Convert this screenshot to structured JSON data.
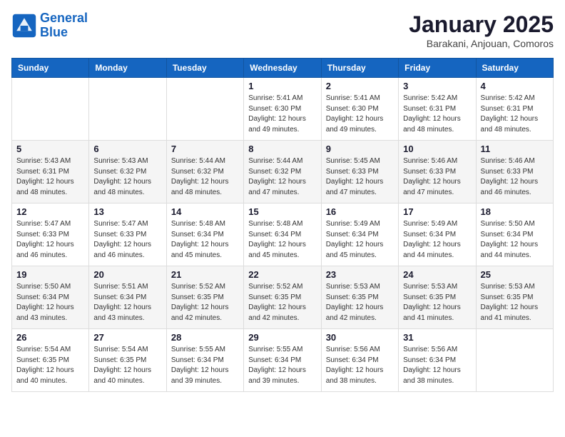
{
  "header": {
    "logo": {
      "line1": "General",
      "line2": "Blue"
    },
    "title": "January 2025",
    "subtitle": "Barakani, Anjouan, Comoros"
  },
  "weekdays": [
    "Sunday",
    "Monday",
    "Tuesday",
    "Wednesday",
    "Thursday",
    "Friday",
    "Saturday"
  ],
  "weeks": [
    {
      "shade": "white",
      "days": [
        {
          "num": "",
          "info": ""
        },
        {
          "num": "",
          "info": ""
        },
        {
          "num": "",
          "info": ""
        },
        {
          "num": "1",
          "info": "Sunrise: 5:41 AM\nSunset: 6:30 PM\nDaylight: 12 hours\nand 49 minutes."
        },
        {
          "num": "2",
          "info": "Sunrise: 5:41 AM\nSunset: 6:30 PM\nDaylight: 12 hours\nand 49 minutes."
        },
        {
          "num": "3",
          "info": "Sunrise: 5:42 AM\nSunset: 6:31 PM\nDaylight: 12 hours\nand 48 minutes."
        },
        {
          "num": "4",
          "info": "Sunrise: 5:42 AM\nSunset: 6:31 PM\nDaylight: 12 hours\nand 48 minutes."
        }
      ]
    },
    {
      "shade": "shade",
      "days": [
        {
          "num": "5",
          "info": "Sunrise: 5:43 AM\nSunset: 6:31 PM\nDaylight: 12 hours\nand 48 minutes."
        },
        {
          "num": "6",
          "info": "Sunrise: 5:43 AM\nSunset: 6:32 PM\nDaylight: 12 hours\nand 48 minutes."
        },
        {
          "num": "7",
          "info": "Sunrise: 5:44 AM\nSunset: 6:32 PM\nDaylight: 12 hours\nand 48 minutes."
        },
        {
          "num": "8",
          "info": "Sunrise: 5:44 AM\nSunset: 6:32 PM\nDaylight: 12 hours\nand 47 minutes."
        },
        {
          "num": "9",
          "info": "Sunrise: 5:45 AM\nSunset: 6:33 PM\nDaylight: 12 hours\nand 47 minutes."
        },
        {
          "num": "10",
          "info": "Sunrise: 5:46 AM\nSunset: 6:33 PM\nDaylight: 12 hours\nand 47 minutes."
        },
        {
          "num": "11",
          "info": "Sunrise: 5:46 AM\nSunset: 6:33 PM\nDaylight: 12 hours\nand 46 minutes."
        }
      ]
    },
    {
      "shade": "white",
      "days": [
        {
          "num": "12",
          "info": "Sunrise: 5:47 AM\nSunset: 6:33 PM\nDaylight: 12 hours\nand 46 minutes."
        },
        {
          "num": "13",
          "info": "Sunrise: 5:47 AM\nSunset: 6:33 PM\nDaylight: 12 hours\nand 46 minutes."
        },
        {
          "num": "14",
          "info": "Sunrise: 5:48 AM\nSunset: 6:34 PM\nDaylight: 12 hours\nand 45 minutes."
        },
        {
          "num": "15",
          "info": "Sunrise: 5:48 AM\nSunset: 6:34 PM\nDaylight: 12 hours\nand 45 minutes."
        },
        {
          "num": "16",
          "info": "Sunrise: 5:49 AM\nSunset: 6:34 PM\nDaylight: 12 hours\nand 45 minutes."
        },
        {
          "num": "17",
          "info": "Sunrise: 5:49 AM\nSunset: 6:34 PM\nDaylight: 12 hours\nand 44 minutes."
        },
        {
          "num": "18",
          "info": "Sunrise: 5:50 AM\nSunset: 6:34 PM\nDaylight: 12 hours\nand 44 minutes."
        }
      ]
    },
    {
      "shade": "shade",
      "days": [
        {
          "num": "19",
          "info": "Sunrise: 5:50 AM\nSunset: 6:34 PM\nDaylight: 12 hours\nand 43 minutes."
        },
        {
          "num": "20",
          "info": "Sunrise: 5:51 AM\nSunset: 6:34 PM\nDaylight: 12 hours\nand 43 minutes."
        },
        {
          "num": "21",
          "info": "Sunrise: 5:52 AM\nSunset: 6:35 PM\nDaylight: 12 hours\nand 42 minutes."
        },
        {
          "num": "22",
          "info": "Sunrise: 5:52 AM\nSunset: 6:35 PM\nDaylight: 12 hours\nand 42 minutes."
        },
        {
          "num": "23",
          "info": "Sunrise: 5:53 AM\nSunset: 6:35 PM\nDaylight: 12 hours\nand 42 minutes."
        },
        {
          "num": "24",
          "info": "Sunrise: 5:53 AM\nSunset: 6:35 PM\nDaylight: 12 hours\nand 41 minutes."
        },
        {
          "num": "25",
          "info": "Sunrise: 5:53 AM\nSunset: 6:35 PM\nDaylight: 12 hours\nand 41 minutes."
        }
      ]
    },
    {
      "shade": "white",
      "days": [
        {
          "num": "26",
          "info": "Sunrise: 5:54 AM\nSunset: 6:35 PM\nDaylight: 12 hours\nand 40 minutes."
        },
        {
          "num": "27",
          "info": "Sunrise: 5:54 AM\nSunset: 6:35 PM\nDaylight: 12 hours\nand 40 minutes."
        },
        {
          "num": "28",
          "info": "Sunrise: 5:55 AM\nSunset: 6:34 PM\nDaylight: 12 hours\nand 39 minutes."
        },
        {
          "num": "29",
          "info": "Sunrise: 5:55 AM\nSunset: 6:34 PM\nDaylight: 12 hours\nand 39 minutes."
        },
        {
          "num": "30",
          "info": "Sunrise: 5:56 AM\nSunset: 6:34 PM\nDaylight: 12 hours\nand 38 minutes."
        },
        {
          "num": "31",
          "info": "Sunrise: 5:56 AM\nSunset: 6:34 PM\nDaylight: 12 hours\nand 38 minutes."
        },
        {
          "num": "",
          "info": ""
        }
      ]
    }
  ]
}
